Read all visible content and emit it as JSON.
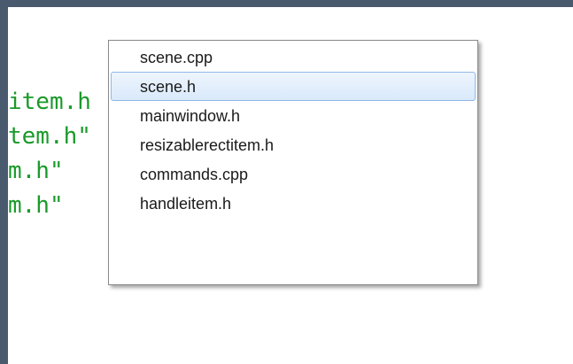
{
  "editor": {
    "code_lines": [
      "item.h",
      "tem.h\"",
      "m.h\"",
      "m.h\""
    ]
  },
  "completion_popup": {
    "items": [
      {
        "label": "scene.cpp",
        "selected": false
      },
      {
        "label": "scene.h",
        "selected": true
      },
      {
        "label": "mainwindow.h",
        "selected": false
      },
      {
        "label": "resizablerectitem.h",
        "selected": false
      },
      {
        "label": "commands.cpp",
        "selected": false
      },
      {
        "label": "handleitem.h",
        "selected": false
      }
    ]
  },
  "colors": {
    "code_text": "#1a9a2a",
    "selection_border": "#8fb8e8",
    "frame": "#4a5a6e"
  }
}
